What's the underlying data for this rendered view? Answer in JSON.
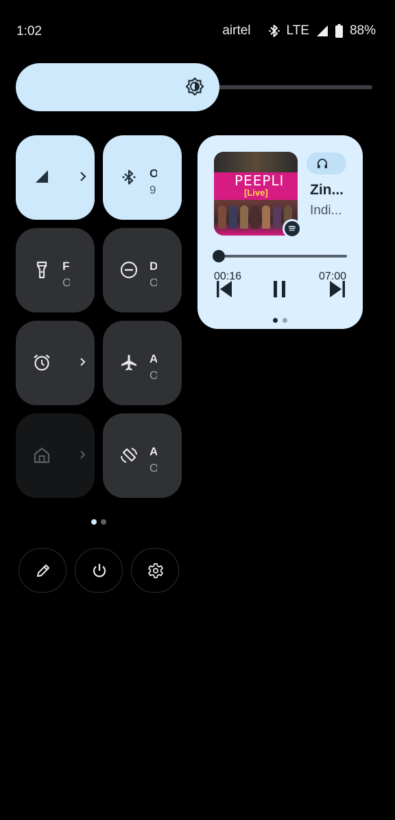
{
  "status_bar": {
    "time": "1:02",
    "carrier": "airtel",
    "network": "LTE",
    "battery": "88%"
  },
  "brightness": {
    "level": 0.55
  },
  "tiles": [
    {
      "id": "mobile-data",
      "title": "",
      "subtitle": "",
      "state": "on",
      "icon": "signal-icon"
    },
    {
      "id": "bluetooth",
      "title": "O",
      "subtitle": "9",
      "state": "on",
      "icon": "bluetooth-icon"
    },
    {
      "id": "flashlight",
      "title": "F",
      "subtitle": "O",
      "state": "off",
      "icon": "flashlight-icon"
    },
    {
      "id": "dnd",
      "title": "D",
      "subtitle": "O",
      "state": "off",
      "icon": "dnd-icon"
    },
    {
      "id": "alarm",
      "title": "",
      "subtitle": "",
      "state": "off",
      "icon": "alarm-icon"
    },
    {
      "id": "airplane",
      "title": "A",
      "subtitle": "O",
      "state": "off",
      "icon": "airplane-icon"
    },
    {
      "id": "home",
      "title": "",
      "subtitle": "",
      "state": "unavailable",
      "icon": "home-icon"
    },
    {
      "id": "autorotate",
      "title": "A",
      "subtitle": "O",
      "state": "off",
      "icon": "rotate-icon"
    }
  ],
  "media": {
    "song": "Zin...",
    "artist": "Indi...",
    "elapsed": "00:16",
    "duration": "07:00",
    "progress": 0.04,
    "album_art": {
      "title": "PEEPLI",
      "subtitle": "[Live]"
    },
    "app_icon": "spotify-icon",
    "output_icon": "headphones-icon"
  },
  "pager": {
    "pages": 2,
    "current": 1
  },
  "media_pager": {
    "pages": 2,
    "current": 1
  },
  "bottom_buttons": [
    {
      "id": "edit",
      "icon": "pencil-icon"
    },
    {
      "id": "power",
      "icon": "power-icon"
    },
    {
      "id": "settings",
      "icon": "gear-icon"
    }
  ],
  "colors": {
    "tile_on": "#cde9fb",
    "tile_off": "#2f3134",
    "media_bg": "#dcefff",
    "background": "#000000"
  }
}
